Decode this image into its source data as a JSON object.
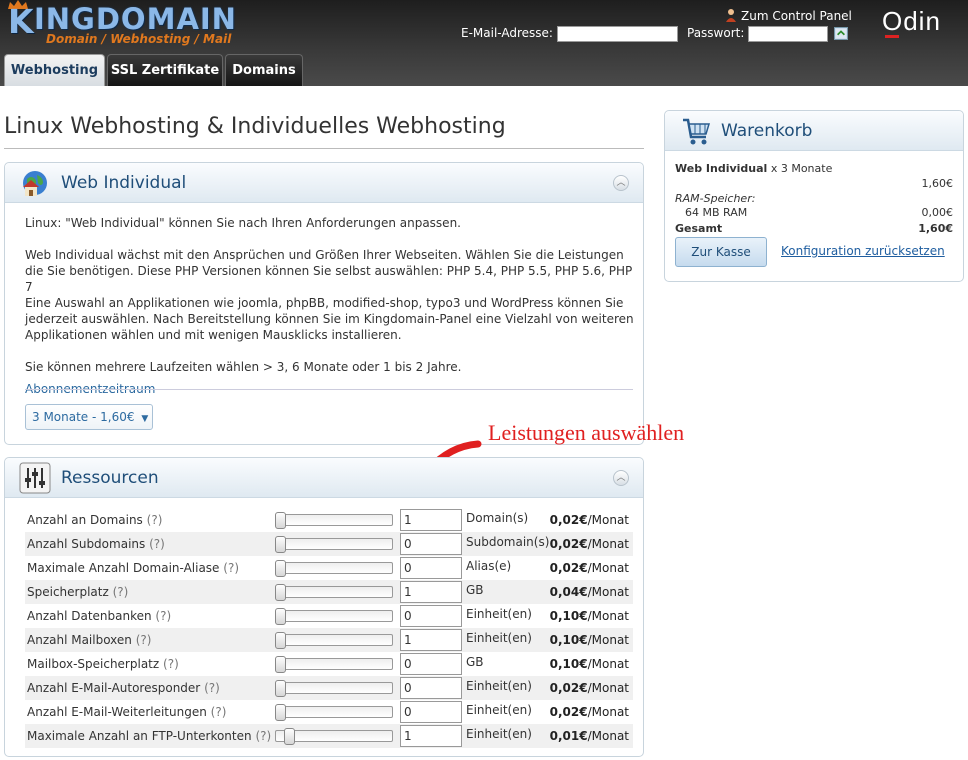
{
  "logo": {
    "text": "INGDOMAIN",
    "letter": "K",
    "tagline": "Domain / Webhosting / Mail"
  },
  "header": {
    "control_panel_link": "Zum Control Panel",
    "email_label": "E-Mail-Adresse:",
    "password_label": "Passwort:",
    "brand": "Odin"
  },
  "tabs": [
    {
      "label": "Webhosting",
      "active": true
    },
    {
      "label": "SSL Zertifikate",
      "active": false
    },
    {
      "label": "Domains",
      "active": false
    }
  ],
  "page_title": "Linux Webhosting & Individuelles Webhosting",
  "product_panel": {
    "title": "Web Individual",
    "paragraphs": [
      "Linux: \"Web Individual\" können Sie nach Ihren Anforderungen anpassen.",
      "Web Individual wächst mit den Ansprüchen und Größen Ihrer Webseiten. Wählen Sie die Leistungen die Sie benötigen. Diese PHP Versionen können Sie selbst auswählen: PHP 5.4, PHP 5.5, PHP 5.6, PHP 7",
      "Eine Auswahl an Applikationen wie joomla, phpBB, modified-shop, typo3 und WordPress können Sie jederzeit auswählen. Nach Bereitstellung können Sie im Kingdomain-Panel eine Vielzahl von weiteren Applikationen wählen und mit wenigen Mausklicks installieren.",
      "Sie können mehrere Laufzeiten wählen > 3, 6 Monate oder 1 bis 2 Jahre."
    ],
    "subscription_label": "Abonnementzeitraum",
    "subscription_value": "3 Monate - 1,60€"
  },
  "annotation": "Leistungen auswählen",
  "resources_panel": {
    "title": "Ressourcen",
    "help": "(?)",
    "rows": [
      {
        "label": "Anzahl an Domains",
        "value": "1",
        "unit": "Domain(s)",
        "price": "0,02€",
        "per": "/Monat",
        "slider_fraction": 0.0
      },
      {
        "label": "Anzahl Subdomains",
        "value": "0",
        "unit": "Subdomain(s)",
        "price": "0,02€",
        "per": "/Monat",
        "slider_fraction": 0.0
      },
      {
        "label": "Maximale Anzahl Domain-Aliase",
        "value": "0",
        "unit": "Alias(e)",
        "price": "0,02€",
        "per": "/Monat",
        "slider_fraction": 0.0
      },
      {
        "label": "Speicherplatz",
        "value": "1",
        "unit": "GB",
        "price": "0,04€",
        "per": "/Monat",
        "slider_fraction": 0.0
      },
      {
        "label": "Anzahl Datenbanken",
        "value": "0",
        "unit": "Einheit(en)",
        "price": "0,10€",
        "per": "/Monat",
        "slider_fraction": 0.0
      },
      {
        "label": "Anzahl Mailboxen",
        "value": "1",
        "unit": "Einheit(en)",
        "price": "0,10€",
        "per": "/Monat",
        "slider_fraction": 0.0
      },
      {
        "label": "Mailbox-Speicherplatz",
        "value": "0",
        "unit": "GB",
        "price": "0,10€",
        "per": "/Monat",
        "slider_fraction": 0.0
      },
      {
        "label": "Anzahl E-Mail-Autoresponder",
        "value": "0",
        "unit": "Einheit(en)",
        "price": "0,02€",
        "per": "/Monat",
        "slider_fraction": 0.0
      },
      {
        "label": "Anzahl E-Mail-Weiterleitungen",
        "value": "0",
        "unit": "Einheit(en)",
        "price": "0,02€",
        "per": "/Monat",
        "slider_fraction": 0.0
      },
      {
        "label": "Maximale Anzahl an FTP-Unterkonten",
        "value": "1",
        "unit": "Einheit(en)",
        "price": "0,01€",
        "per": "/Monat",
        "slider_fraction": 0.05
      }
    ]
  },
  "cart": {
    "title": "Warenkorb",
    "item_name": "Web Individual",
    "item_duration": "x 3 Monate",
    "item_price": "1,60€",
    "ram_label": "RAM-Speicher:",
    "ram_value": "64 MB RAM",
    "ram_price": "0,00€",
    "total_label": "Gesamt",
    "total_price": "1,60€",
    "checkout_button": "Zur Kasse",
    "reset_link": "Konfiguration zurücksetzen"
  },
  "colors": {
    "accent": "#1f4e79",
    "annotation": "#e02020",
    "logo_blue": "#8bb8e8",
    "logo_orange": "#e0781e"
  }
}
